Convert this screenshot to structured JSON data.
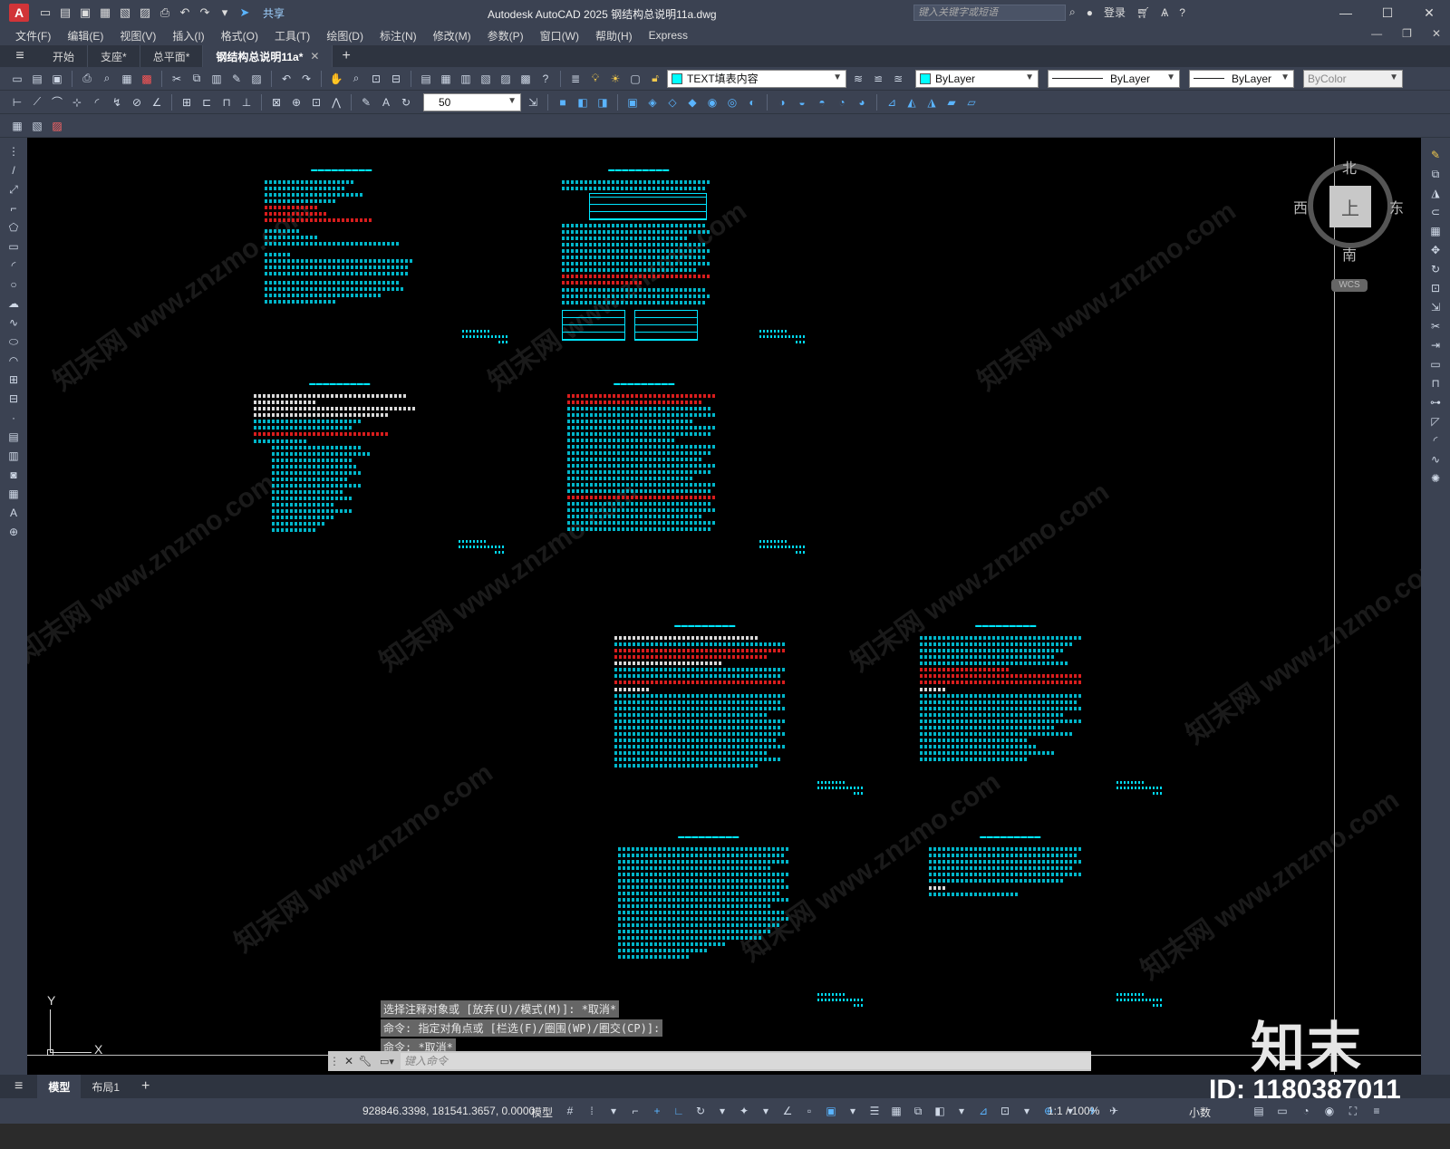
{
  "app": {
    "window_title": "Autodesk AutoCAD 2025    钢结构总说明11a.dwg",
    "share_label": "共享",
    "search_placeholder": "键入关键字或短语",
    "login_label": "登录"
  },
  "menu": {
    "items": [
      "文件(F)",
      "编辑(E)",
      "视图(V)",
      "插入(I)",
      "格式(O)",
      "工具(T)",
      "绘图(D)",
      "标注(N)",
      "修改(M)",
      "参数(P)",
      "窗口(W)",
      "帮助(H)",
      "Express"
    ]
  },
  "file_tabs": [
    {
      "label": "开始",
      "active": false
    },
    {
      "label": "支座*",
      "active": false
    },
    {
      "label": "总平面*",
      "active": false
    },
    {
      "label": "钢结构总说明11a*",
      "active": true
    }
  ],
  "toolbar": {
    "layer_name": "TEXT填表内容",
    "color_value": "ByLayer",
    "linetype_value": "ByLayer",
    "lineweight_value": "ByLayer",
    "plotstyle_value": "ByColor",
    "dim_scale_value": "50"
  },
  "viewcube": {
    "north": "北",
    "south": "南",
    "east": "东",
    "west": "西",
    "face": "上",
    "wcs_label": "WCS"
  },
  "ucs": {
    "x_label": "X",
    "y_label": "Y"
  },
  "command": {
    "history": [
      "选择注释对象或 [放弃(U)/模式(M)]: *取消*",
      "命令: 指定对角点或 [栏选(F)/圈围(WP)/圈交(CP)]:",
      "命令: *取消*"
    ],
    "input_placeholder": "键入命令"
  },
  "layout_tabs": [
    {
      "label": "模型",
      "active": true
    },
    {
      "label": "布局1",
      "active": false
    }
  ],
  "status": {
    "coordinates": "928846.3398, 181541.3657, 0.0000",
    "model_label": "模型",
    "annotation_scale": "1:1 / 100%",
    "units": "小数"
  },
  "watermark": {
    "logo": "知末",
    "id_label": "ID: 1180387011",
    "text": "知末网 www.znzmo.com"
  },
  "colors": {
    "drawing_text": "#00e5ff",
    "drawing_red": "#ff2222",
    "canvas_bg": "#000000",
    "chrome_bg": "#3b4252"
  }
}
